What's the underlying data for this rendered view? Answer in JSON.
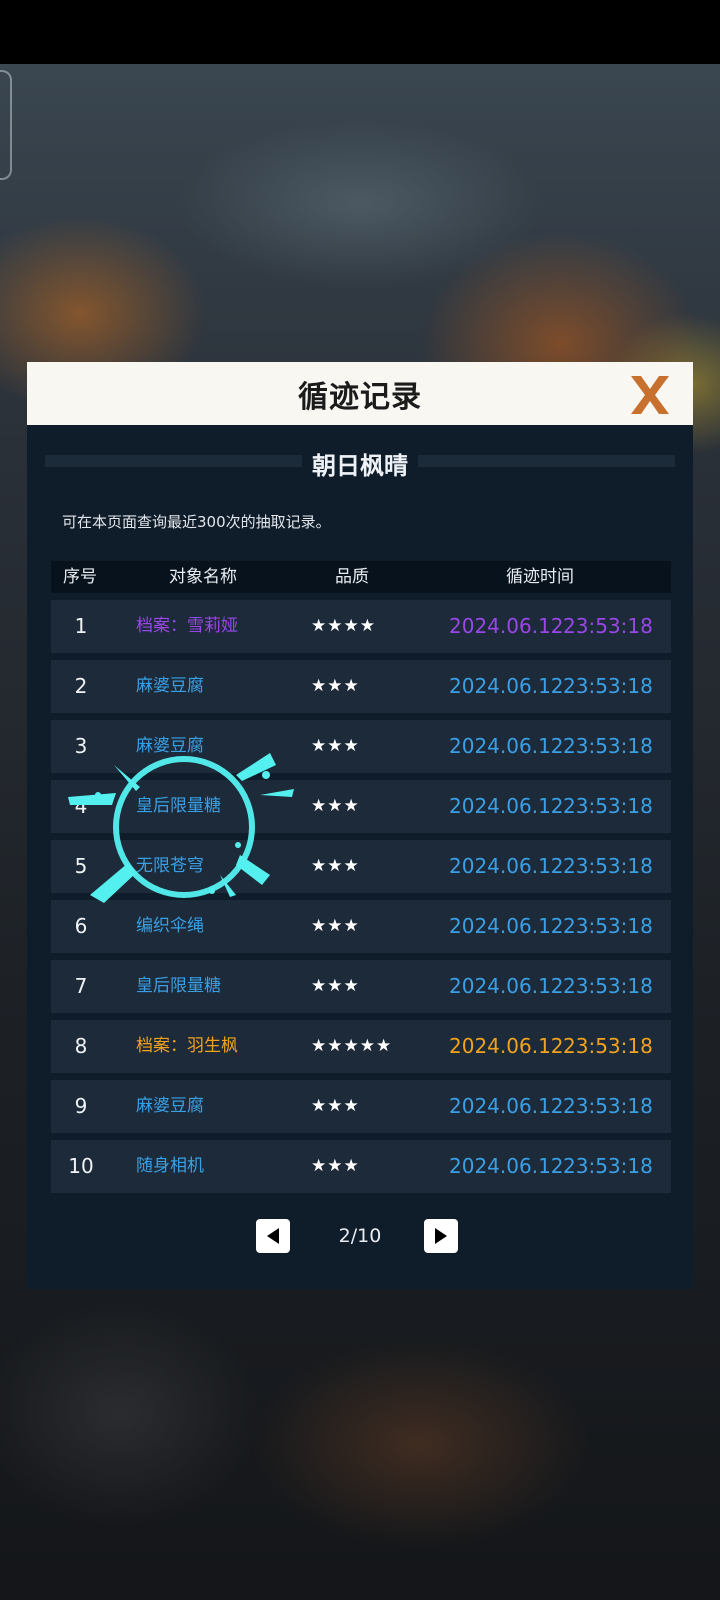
{
  "dialog": {
    "title": "循迹记录",
    "banner": "朝日枫晴",
    "note": "可在本页面查询最近300次的抽取记录。"
  },
  "columns": {
    "index": "序号",
    "name": "对象名称",
    "quality": "品质",
    "time": "循迹时间"
  },
  "records": [
    {
      "index": "1",
      "name": "档案：雪莉娅",
      "stars": "★★★★",
      "date": "2024.06.12",
      "time": "23:53:18",
      "quality_color": "#9a46e8"
    },
    {
      "index": "2",
      "name": "麻婆豆腐",
      "stars": "★★★",
      "date": "2024.06.12",
      "time": "23:53:18",
      "quality_color": "#3aa0e6"
    },
    {
      "index": "3",
      "name": "麻婆豆腐",
      "stars": "★★★",
      "date": "2024.06.12",
      "time": "23:53:18",
      "quality_color": "#3aa0e6"
    },
    {
      "index": "4",
      "name": "皇后限量糖",
      "stars": "★★★",
      "date": "2024.06.12",
      "time": "23:53:18",
      "quality_color": "#3aa0e6"
    },
    {
      "index": "5",
      "name": "无限苍穹",
      "stars": "★★★",
      "date": "2024.06.12",
      "time": "23:53:18",
      "quality_color": "#3aa0e6"
    },
    {
      "index": "6",
      "name": "编织伞绳",
      "stars": "★★★",
      "date": "2024.06.12",
      "time": "23:53:18",
      "quality_color": "#3aa0e6"
    },
    {
      "index": "7",
      "name": "皇后限量糖",
      "stars": "★★★",
      "date": "2024.06.12",
      "time": "23:53:18",
      "quality_color": "#3aa0e6"
    },
    {
      "index": "8",
      "name": "档案：羽生枫",
      "stars": "★★★★★",
      "date": "2024.06.12",
      "time": "23:53:18",
      "quality_color": "#f2a21c"
    },
    {
      "index": "9",
      "name": "麻婆豆腐",
      "stars": "★★★",
      "date": "2024.06.12",
      "time": "23:53:18",
      "quality_color": "#3aa0e6"
    },
    {
      "index": "10",
      "name": "随身相机",
      "stars": "★★★",
      "date": "2024.06.12",
      "time": "23:53:18",
      "quality_color": "#3aa0e6"
    }
  ],
  "pager": {
    "label": "2/10"
  },
  "icons": {
    "close": "close-x-icon",
    "prev": "triangle-left-icon",
    "next": "triangle-right-icon"
  },
  "colors": {
    "accent_close": "#c8702e",
    "quality_3": "#3aa0e6",
    "quality_4": "#9a46e8",
    "quality_5": "#f2a21c"
  }
}
